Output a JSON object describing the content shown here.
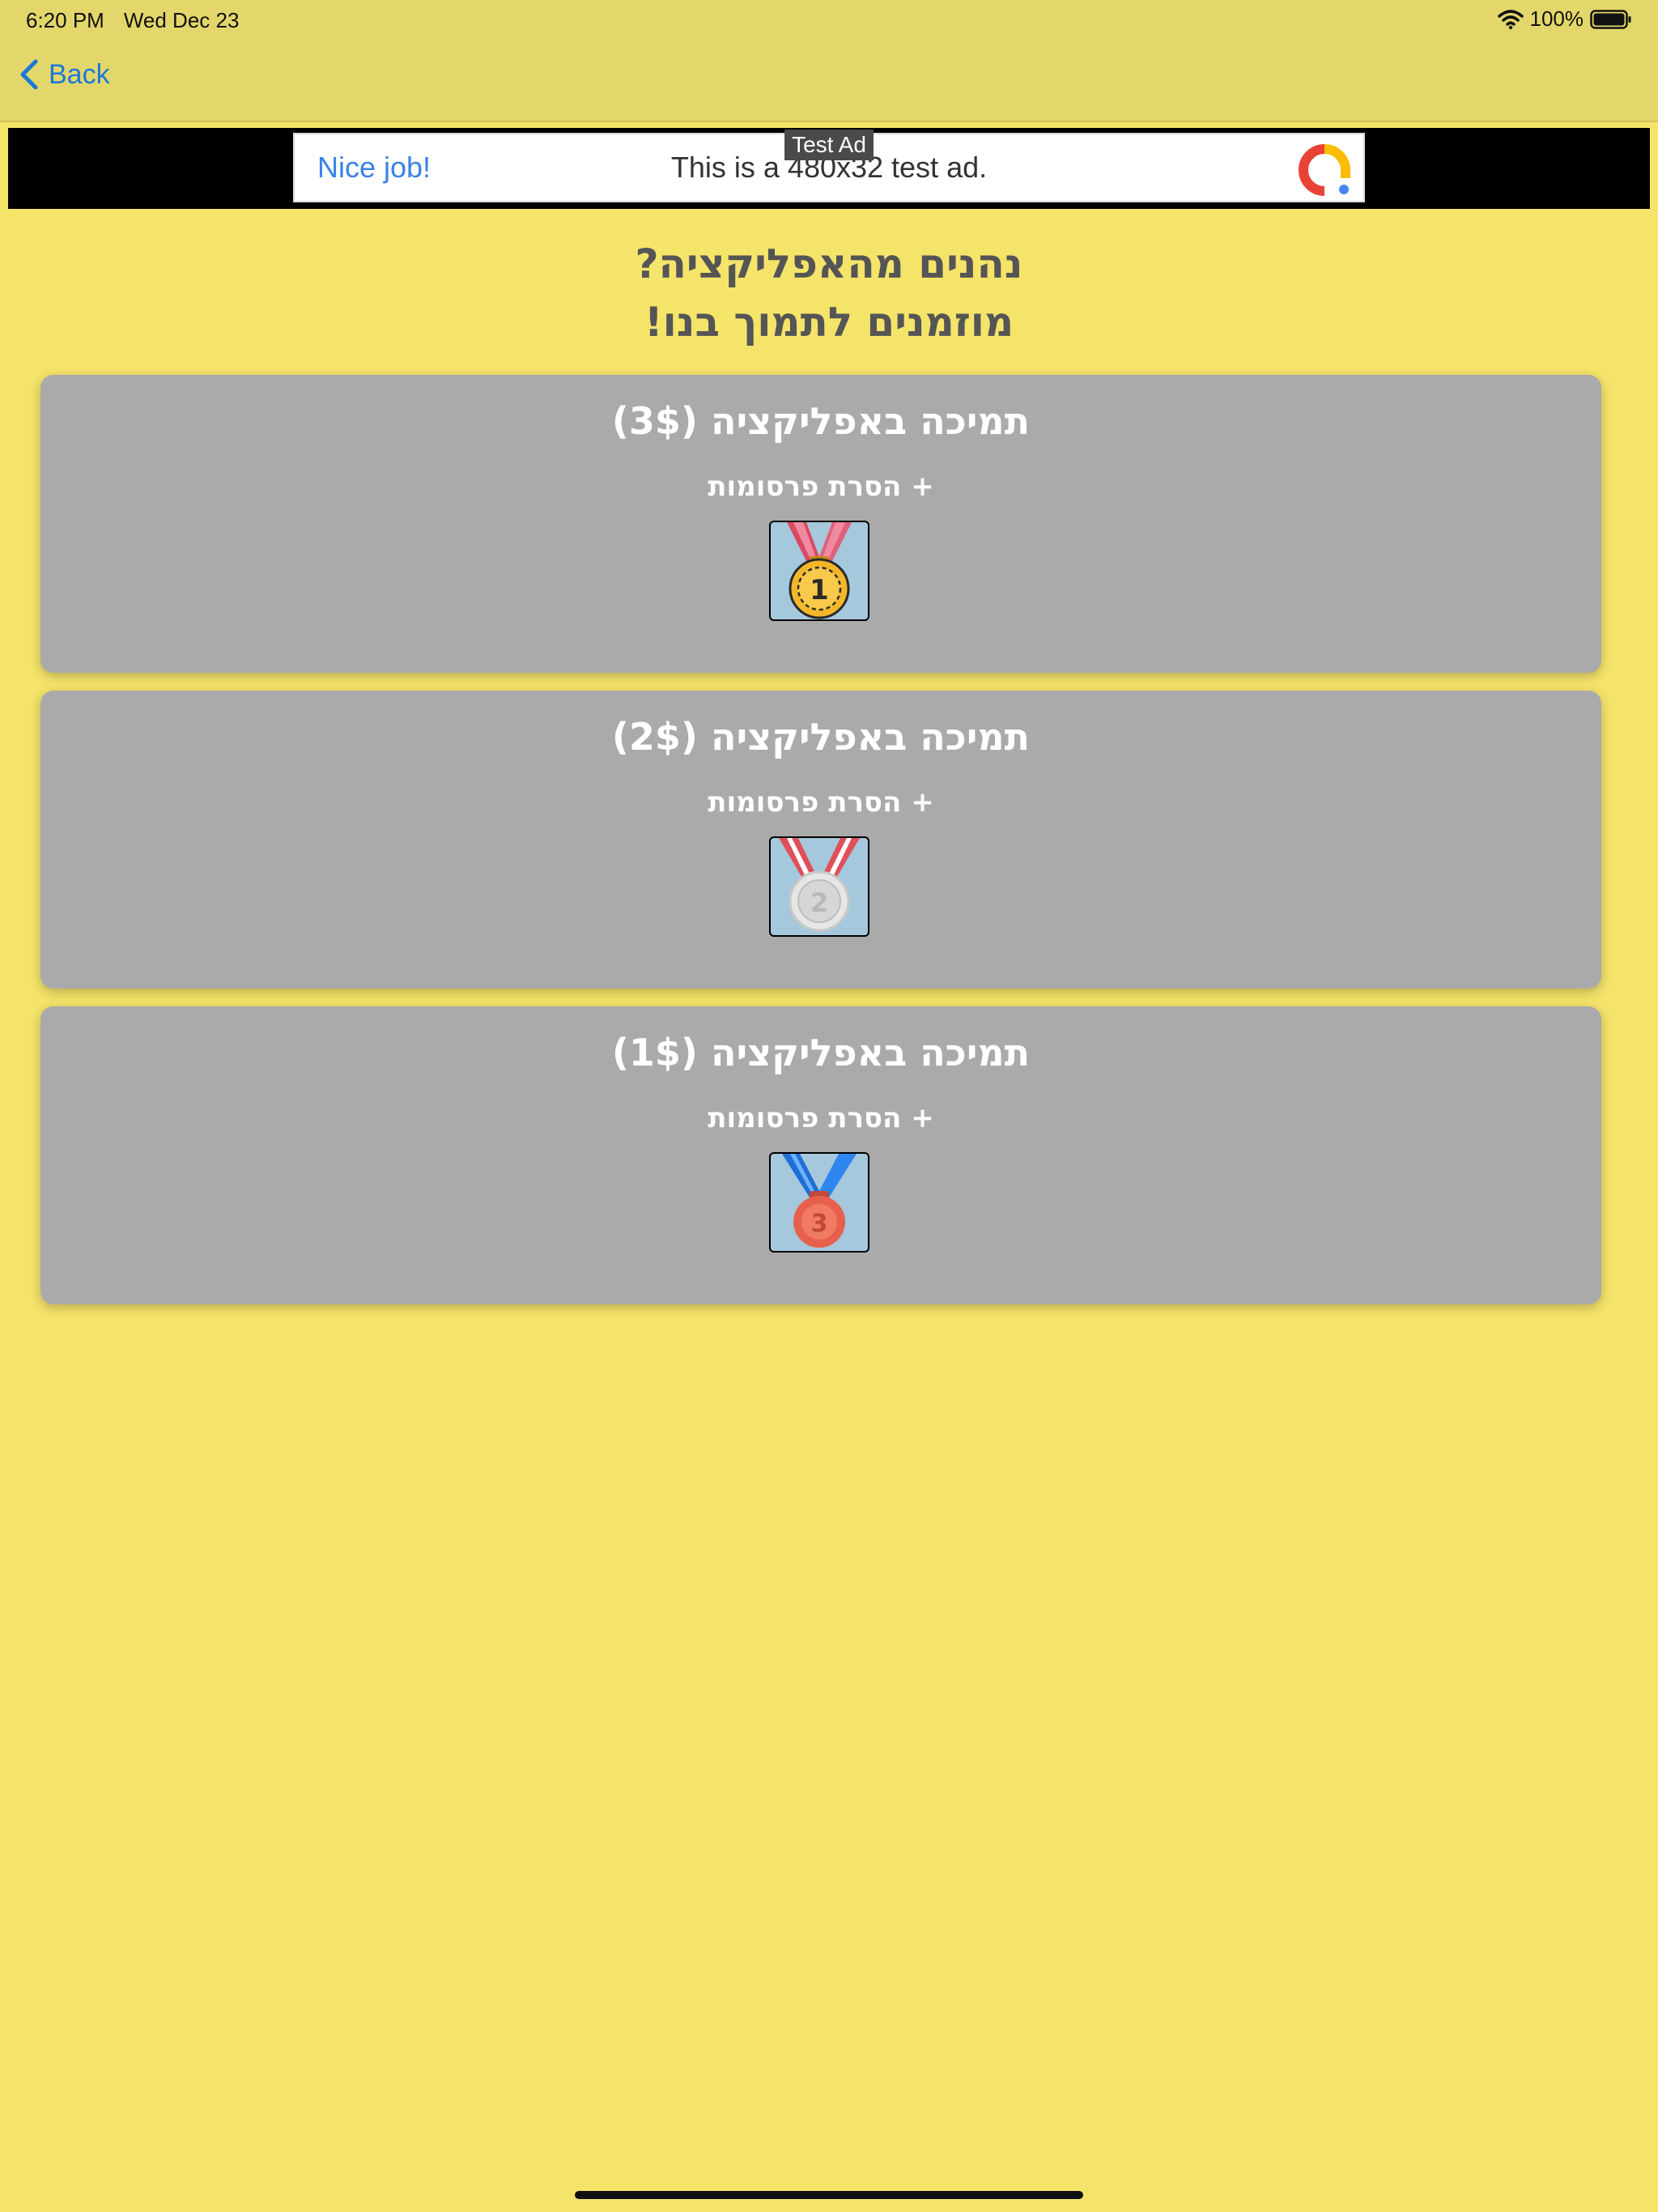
{
  "status_bar": {
    "time": "6:20 PM",
    "date": "Wed Dec 23",
    "battery_percent": "100%",
    "battery_level": 1.0
  },
  "nav": {
    "back_label": "Back"
  },
  "ad": {
    "badge": "Test Ad",
    "headline": "Nice job!",
    "text": "This is a 480x32 test ad."
  },
  "headline": {
    "line1": "נהנים מהאפליקציה?",
    "line2": "מוזמנים לתמוך בנו!"
  },
  "cards": [
    {
      "title": "תמיכה באפליקציה (3$)",
      "subtitle": "+ הסרת פרסומות",
      "medal": "gold-medal-icon",
      "medal_number": "1"
    },
    {
      "title": "תמיכה באפליקציה (2$)",
      "subtitle": "+ הסרת פרסומות",
      "medal": "silver-medal-icon",
      "medal_number": "2"
    },
    {
      "title": "תמיכה באפליקציה (1$)",
      "subtitle": "+ הסרת פרסומות",
      "medal": "bronze-medal-icon",
      "medal_number": "3"
    }
  ],
  "colors": {
    "background": "#f5e46a",
    "nav_background": "#e3d76b",
    "card_background": "#aaaaaa",
    "link_blue": "#1b78d6"
  }
}
